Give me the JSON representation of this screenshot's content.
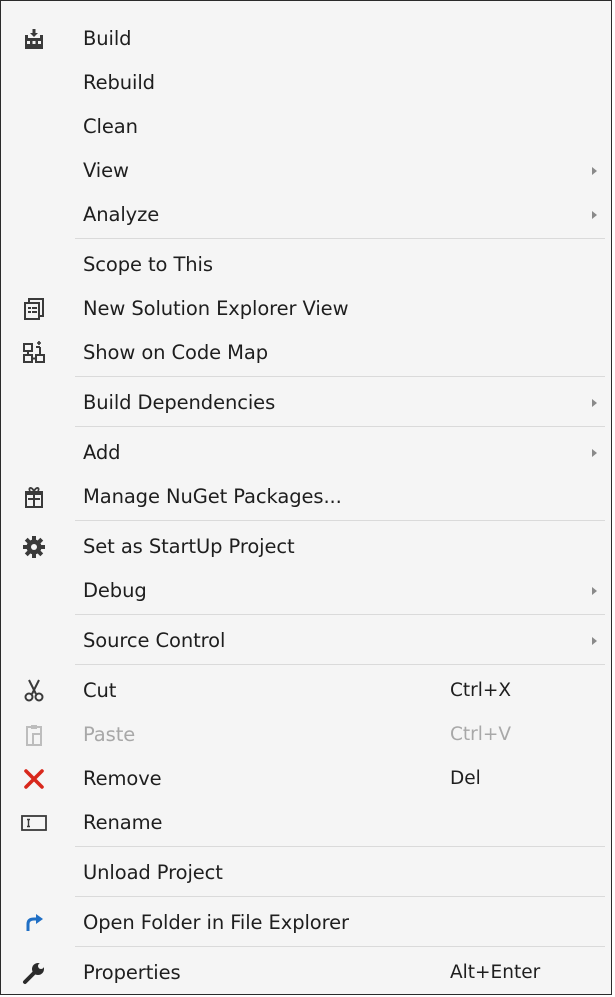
{
  "menu": {
    "items": {
      "build": {
        "label": "Build",
        "icon": "build-icon"
      },
      "rebuild": {
        "label": "Rebuild"
      },
      "clean": {
        "label": "Clean"
      },
      "view": {
        "label": "View",
        "submenu": true
      },
      "analyze": {
        "label": "Analyze",
        "submenu": true
      },
      "scope_to_this": {
        "label": "Scope to This"
      },
      "new_solution_explorer_view": {
        "label": "New Solution Explorer View",
        "icon": "solution-explorer-view-icon"
      },
      "show_on_code_map": {
        "label": "Show on Code Map",
        "icon": "code-map-icon"
      },
      "build_dependencies": {
        "label": "Build Dependencies",
        "submenu": true
      },
      "add": {
        "label": "Add",
        "submenu": true
      },
      "manage_nuget": {
        "label": "Manage NuGet Packages...",
        "icon": "nuget-package-icon"
      },
      "set_startup": {
        "label": "Set as StartUp Project",
        "icon": "gear-icon"
      },
      "debug": {
        "label": "Debug",
        "submenu": true
      },
      "source_control": {
        "label": "Source Control",
        "submenu": true
      },
      "cut": {
        "label": "Cut",
        "shortcut": "Ctrl+X",
        "icon": "scissors-icon"
      },
      "paste": {
        "label": "Paste",
        "shortcut": "Ctrl+V",
        "icon": "clipboard-icon",
        "disabled": true
      },
      "remove": {
        "label": "Remove",
        "shortcut": "Del",
        "icon": "red-x-icon"
      },
      "rename": {
        "label": "Rename",
        "icon": "rename-icon"
      },
      "unload_project": {
        "label": "Unload Project"
      },
      "open_folder": {
        "label": "Open Folder in File Explorer",
        "icon": "redirect-arrow-icon"
      },
      "properties": {
        "label": "Properties",
        "shortcut": "Alt+Enter",
        "icon": "wrench-icon"
      }
    }
  },
  "colors": {
    "menu_background": "#f5f5f5",
    "text": "#1e1e1e",
    "disabled_text": "#a8a8a8",
    "separator": "#dadada",
    "remove_red": "#d8281c",
    "open_folder_blue": "#1f6fc5"
  }
}
